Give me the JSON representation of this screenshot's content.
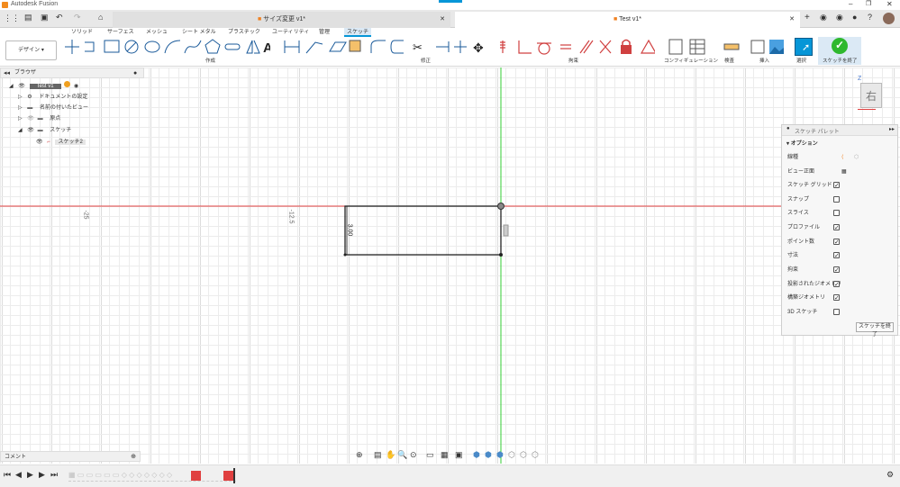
{
  "app": {
    "title": "Autodesk Fusion"
  },
  "doc_tabs": [
    {
      "label": "サイズ変更 v1*"
    },
    {
      "label": "Test v1*"
    }
  ],
  "menu_tabs": [
    "ソリッド",
    "サーフェス",
    "メッシュ",
    "シート メタル",
    "プラスチック",
    "ユーティリティ",
    "管理",
    "スケッチ"
  ],
  "workspace": "デザイン",
  "ribbon_groups": {
    "create": "作成",
    "modify": "修正",
    "constraints": "拘束",
    "configure": "コンフィギュレーション",
    "inspect": "検査",
    "insert": "挿入",
    "select": "選択",
    "finish": "スケッチを終了"
  },
  "browser": {
    "title": "ブラウザ",
    "root": "Test v1",
    "items": [
      "ドキュメントの設定",
      "名前の付いたビュー",
      "原点",
      "スケッチ",
      "スケッチ2"
    ]
  },
  "canvas": {
    "axis_labels": [
      "-25",
      "-12.5"
    ],
    "dimension": "3.00",
    "viewcube": "右",
    "z_label": "Z"
  },
  "palette": {
    "title": "スケッチ パレット",
    "section": "オプション",
    "rows": [
      {
        "label": "線種",
        "checked": null
      },
      {
        "label": "ビュー正面",
        "checked": null
      },
      {
        "label": "スケッチ グリッド",
        "checked": true
      },
      {
        "label": "スナップ",
        "checked": false
      },
      {
        "label": "スライス",
        "checked": false
      },
      {
        "label": "プロファイル",
        "checked": true
      },
      {
        "label": "ポイント数",
        "checked": true
      },
      {
        "label": "寸法",
        "checked": true
      },
      {
        "label": "拘束",
        "checked": true
      },
      {
        "label": "投影されたジオメトリ",
        "checked": true
      },
      {
        "label": "構築ジオメトリ",
        "checked": true
      },
      {
        "label": "3D スケッチ",
        "checked": false
      }
    ],
    "finish_button": "スケッチを終了"
  },
  "comment": {
    "label": "コメント"
  },
  "colors": {
    "accent": "#0696d7",
    "finish": "#2eb82e",
    "axis_x": "#e04040",
    "axis_y": "#33cc33",
    "orange": "#f08020"
  }
}
